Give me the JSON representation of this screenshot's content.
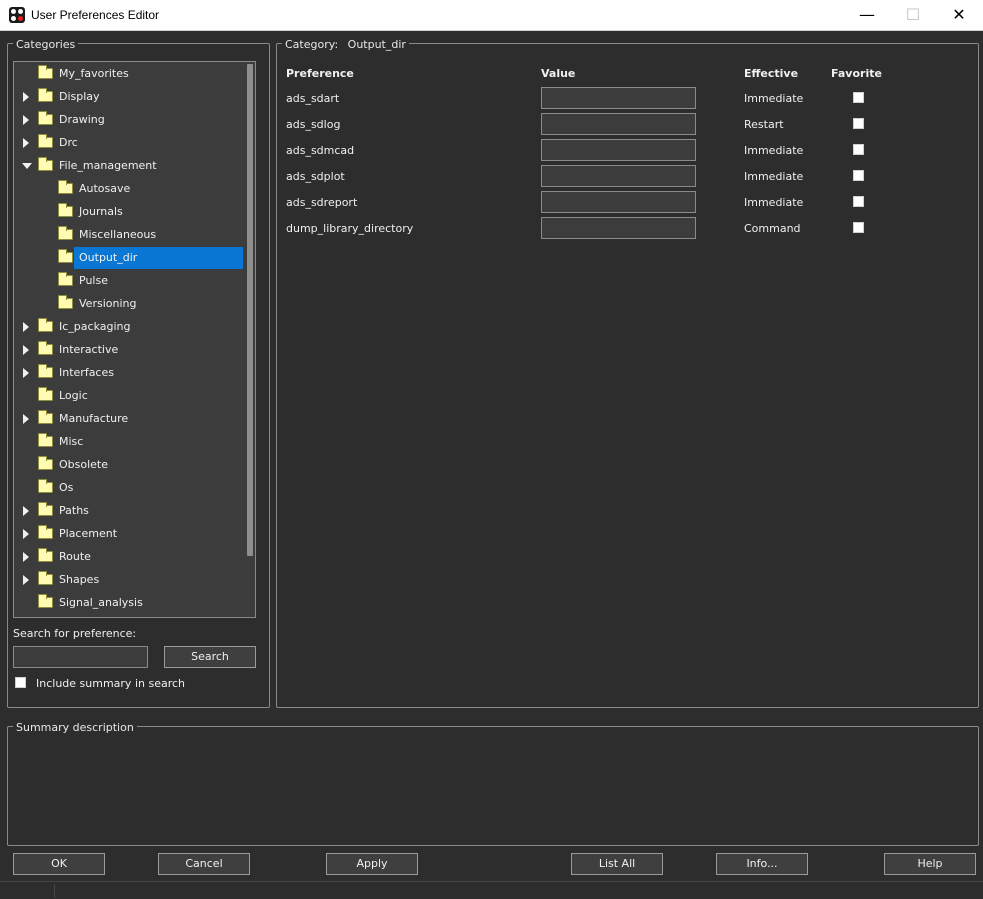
{
  "window": {
    "title": "User Preferences Editor",
    "minimize_glyph": "—",
    "maximize_glyph": "☐",
    "close_glyph": "✕"
  },
  "categories": {
    "legend": "Categories",
    "items": [
      {
        "label": "My_favorites",
        "expander": "none",
        "level": 0
      },
      {
        "label": "Display",
        "expander": "collapsed",
        "level": 0
      },
      {
        "label": "Drawing",
        "expander": "collapsed",
        "level": 0
      },
      {
        "label": "Drc",
        "expander": "collapsed",
        "level": 0
      },
      {
        "label": "File_management",
        "expander": "expanded",
        "level": 0
      },
      {
        "label": "Autosave",
        "expander": "none",
        "level": 1
      },
      {
        "label": "Journals",
        "expander": "none",
        "level": 1
      },
      {
        "label": "Miscellaneous",
        "expander": "none",
        "level": 1
      },
      {
        "label": "Output_dir",
        "expander": "none",
        "level": 1,
        "selected": true
      },
      {
        "label": "Pulse",
        "expander": "none",
        "level": 1
      },
      {
        "label": "Versioning",
        "expander": "none",
        "level": 1
      },
      {
        "label": "Ic_packaging",
        "expander": "collapsed",
        "level": 0
      },
      {
        "label": "Interactive",
        "expander": "collapsed",
        "level": 0
      },
      {
        "label": "Interfaces",
        "expander": "collapsed",
        "level": 0
      },
      {
        "label": "Logic",
        "expander": "none",
        "level": 0
      },
      {
        "label": "Manufacture",
        "expander": "collapsed",
        "level": 0
      },
      {
        "label": "Misc",
        "expander": "none",
        "level": 0
      },
      {
        "label": "Obsolete",
        "expander": "none",
        "level": 0
      },
      {
        "label": "Os",
        "expander": "none",
        "level": 0
      },
      {
        "label": "Paths",
        "expander": "collapsed",
        "level": 0
      },
      {
        "label": "Placement",
        "expander": "collapsed",
        "level": 0
      },
      {
        "label": "Route",
        "expander": "collapsed",
        "level": 0
      },
      {
        "label": "Shapes",
        "expander": "collapsed",
        "level": 0
      },
      {
        "label": "Signal_analysis",
        "expander": "none",
        "level": 0
      }
    ]
  },
  "search": {
    "label": "Search for preference:",
    "value": "",
    "button_label": "Search",
    "include_summary_label": "Include summary in search",
    "include_summary_checked": false
  },
  "category_panel": {
    "legend_prefix": "Category:",
    "legend_value": "Output_dir",
    "headers": {
      "preference": "Preference",
      "value": "Value",
      "effective": "Effective",
      "favorite": "Favorite"
    },
    "rows": [
      {
        "name": "ads_sdart",
        "value": "",
        "effective": "Immediate",
        "favorite": false
      },
      {
        "name": "ads_sdlog",
        "value": "",
        "effective": "Restart",
        "favorite": false
      },
      {
        "name": "ads_sdmcad",
        "value": "",
        "effective": "Immediate",
        "favorite": false
      },
      {
        "name": "ads_sdplot",
        "value": "",
        "effective": "Immediate",
        "favorite": false
      },
      {
        "name": "ads_sdreport",
        "value": "",
        "effective": "Immediate",
        "favorite": false
      },
      {
        "name": "dump_library_directory",
        "value": "",
        "effective": "Command",
        "favorite": false
      }
    ]
  },
  "summary": {
    "legend": "Summary description",
    "text": ""
  },
  "buttons": {
    "ok": "OK",
    "cancel": "Cancel",
    "apply": "Apply",
    "list_all": "List All",
    "info": "Info...",
    "help": "Help"
  },
  "colors": {
    "background": "#2d2d2d",
    "selection": "#0a77d4",
    "folder": "#fffbb2"
  }
}
